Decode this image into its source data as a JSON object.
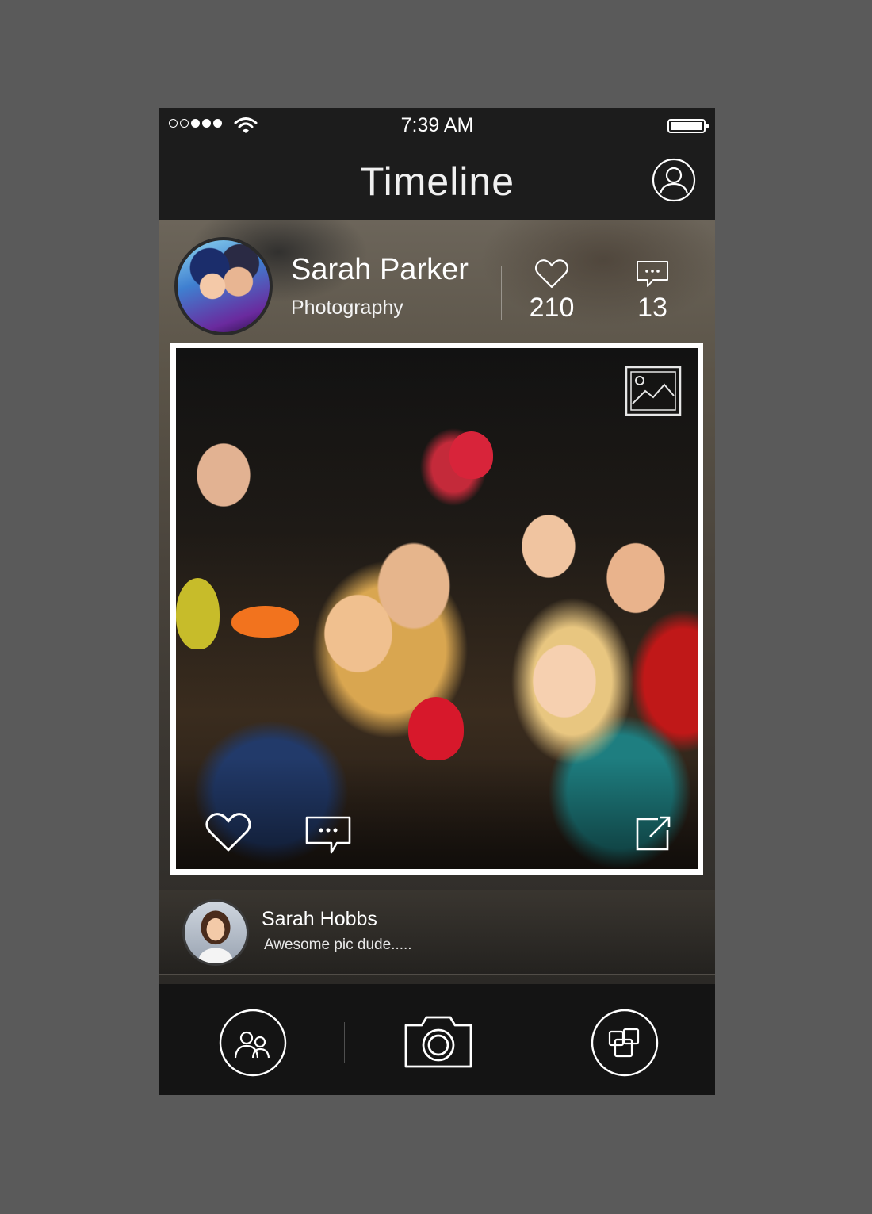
{
  "status_bar": {
    "time": "7:39 AM",
    "signal_dots": [
      "off",
      "off",
      "on",
      "on",
      "on"
    ],
    "wifi_icon": "wifi-icon",
    "battery_icon": "battery-icon"
  },
  "nav": {
    "title": "Timeline",
    "profile_icon": "user-profile-icon"
  },
  "post": {
    "author_name": "Sarah Parker",
    "author_category": "Photography",
    "likes_count": "210",
    "comments_count": "13",
    "like_icon": "heart-icon",
    "comment_icon": "speech-bubble-icon",
    "photo_type_icon": "image-icon",
    "share_icon": "share-icon"
  },
  "comment": {
    "author": "Sarah Hobbs",
    "text": "Awesome pic dude....."
  },
  "tab_bar": {
    "items": [
      {
        "icon": "friends-icon"
      },
      {
        "icon": "camera-icon"
      },
      {
        "icon": "gallery-icon"
      }
    ]
  },
  "colors": {
    "background": "#5a5a5a",
    "bar": "#1c1c1c",
    "tab_bar": "#141414",
    "text": "#ffffff"
  }
}
